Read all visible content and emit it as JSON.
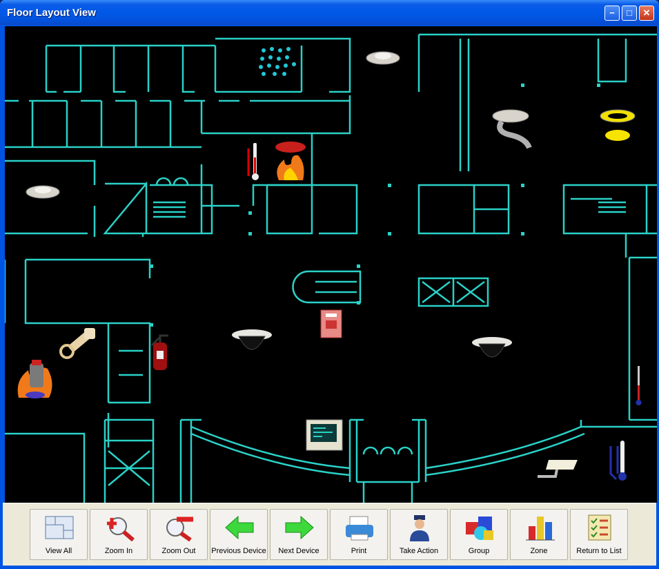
{
  "window": {
    "title": "Floor Layout View",
    "controls": {
      "minimize": "minimize-icon",
      "maximize": "maximize-icon",
      "close": "close-icon"
    }
  },
  "floor_plan": {
    "wall_color": "#2ad2c8",
    "background": "#000000",
    "devices": [
      {
        "type": "sprinkler-icon"
      },
      {
        "type": "smoke-detector-icon"
      },
      {
        "type": "smoke-detector-icon"
      },
      {
        "type": "heat-detector-icon"
      },
      {
        "type": "strobe-light-icon"
      },
      {
        "type": "thermometer-icon"
      },
      {
        "type": "fire-detector-icon"
      },
      {
        "type": "pull-station-icon"
      },
      {
        "type": "dome-camera-icon"
      },
      {
        "type": "dome-camera-icon"
      },
      {
        "type": "fire-extinguisher-icon"
      },
      {
        "type": "valve-icon"
      },
      {
        "type": "fire-hydrant-icon"
      },
      {
        "type": "control-panel-icon"
      },
      {
        "type": "security-camera-icon"
      },
      {
        "type": "temperature-sensor-icon"
      },
      {
        "type": "temperature-sensor-icon"
      }
    ]
  },
  "toolbar": {
    "view_all": "View All",
    "zoom_in": "Zoom In",
    "zoom_out": "Zoom Out",
    "previous_device": "Previous Device",
    "next_device": "Next Device",
    "print": "Print",
    "take_action": "Take Action",
    "group": "Group",
    "zone": "Zone",
    "return_to_list": "Return to List"
  }
}
